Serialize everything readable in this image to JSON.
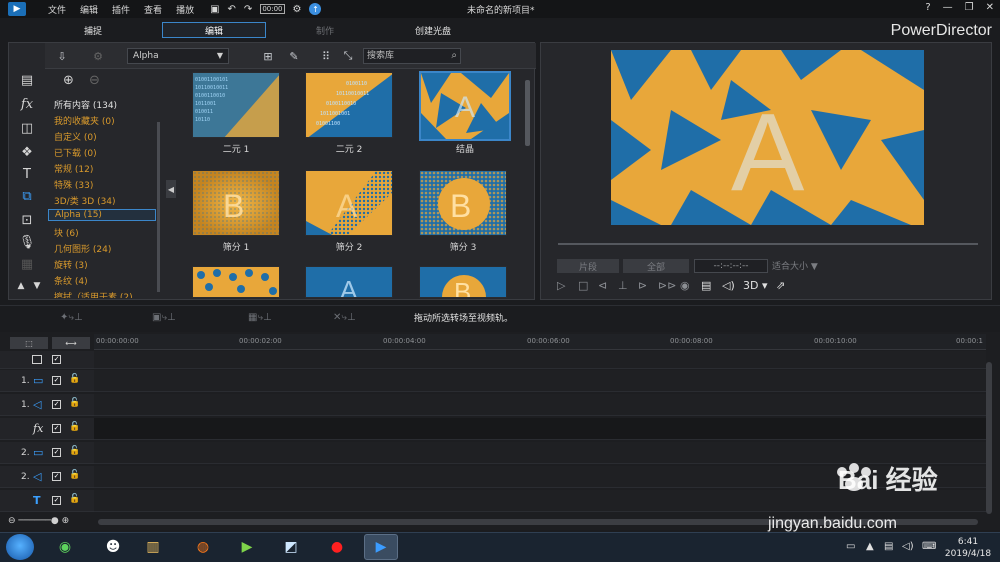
{
  "menu": [
    "文件",
    "编辑",
    "插件",
    "查看",
    "播放"
  ],
  "project_title": "未命名的新项目*",
  "timecode_badge": "00:00",
  "window_controls": [
    "?",
    "—",
    "❐",
    "✕"
  ],
  "modes": [
    {
      "label": "捕捉"
    },
    {
      "label": "编辑"
    },
    {
      "label": "制作"
    },
    {
      "label": "创建光盘"
    }
  ],
  "brand": "PowerDirector",
  "library": {
    "filter_dropdown": "Alpha",
    "search_placeholder": "搜索库"
  },
  "categories": [
    "所有内容 (134)",
    "我的收藏夹 (0)",
    "自定义 (0)",
    "已下载 (0)",
    "常规 (12)",
    "特殊 (33)",
    "3D/类 3D (34)",
    "Alpha (15)",
    "块 (6)",
    "几何图形 (24)",
    "旋转 (3)",
    "条纹 (4)",
    "擦拭（适用于素 (2)"
  ],
  "transitions": [
    {
      "label": "二元 1"
    },
    {
      "label": "二元 2"
    },
    {
      "label": "结晶"
    },
    {
      "label": "筛分 1"
    },
    {
      "label": "筛分 2"
    },
    {
      "label": "筛分 3"
    }
  ],
  "thumb_letters": {
    "b": "B",
    "a": "A"
  },
  "preview": {
    "btn_clip": "片段",
    "btn_movie": "全部",
    "timecode": "--:--:--:--",
    "fit": "适合大小",
    "mode_3d": "3D"
  },
  "timeline": {
    "hint": "拖动所选转场至视频轨。",
    "ticks": [
      "00:00:00:00",
      "00:00:02:00",
      "00:00:04:00",
      "00:00:06:00",
      "00:00:08:00",
      "00:00:10:00",
      "00:00:1"
    ],
    "tracks": [
      {
        "num": "1.",
        "icon": "video-track-icon"
      },
      {
        "num": "1.",
        "icon": "audio-track-icon"
      },
      {
        "num": "",
        "icon": "fx-track-icon"
      },
      {
        "num": "2.",
        "icon": "video-track-icon"
      },
      {
        "num": "2.",
        "icon": "audio-track-icon"
      },
      {
        "num": "",
        "icon": "title-track-icon"
      }
    ]
  },
  "taskbar": {
    "time": "6:41",
    "date": "2019/4/18"
  },
  "watermark": {
    "text": "Bai 经验",
    "url": "jingyan.baidu.com"
  },
  "colors": {
    "accent": "#3b86c9",
    "category_text": "#d99a2c",
    "transition_gold": "#e8a73a",
    "transition_blue": "#1f6ea8"
  }
}
